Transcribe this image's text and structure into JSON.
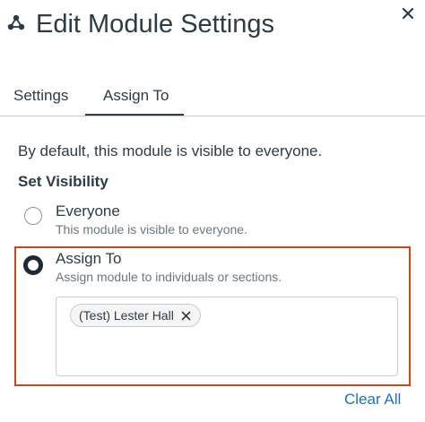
{
  "header": {
    "title": "Edit Module Settings",
    "icon": "module-icon",
    "close_icon": "close-icon"
  },
  "tabs": [
    {
      "label": "Settings",
      "selected": false
    },
    {
      "label": "Assign To",
      "selected": true
    }
  ],
  "main": {
    "description": "By default, this module is visible to everyone.",
    "section_title": "Set Visibility",
    "options": [
      {
        "label": "Everyone",
        "description": "This module is visible to everyone.",
        "selected": false
      },
      {
        "label": "Assign To",
        "description": "Assign module to individuals or sections.",
        "selected": true
      }
    ],
    "assignees": [
      {
        "label": "(Test) Lester Hall"
      }
    ],
    "clear_all": "Clear All"
  },
  "colors": {
    "text": "#2d3b45",
    "muted": "#6b7780",
    "highlight_border": "#d6421e",
    "link": "#1f6fbf"
  }
}
